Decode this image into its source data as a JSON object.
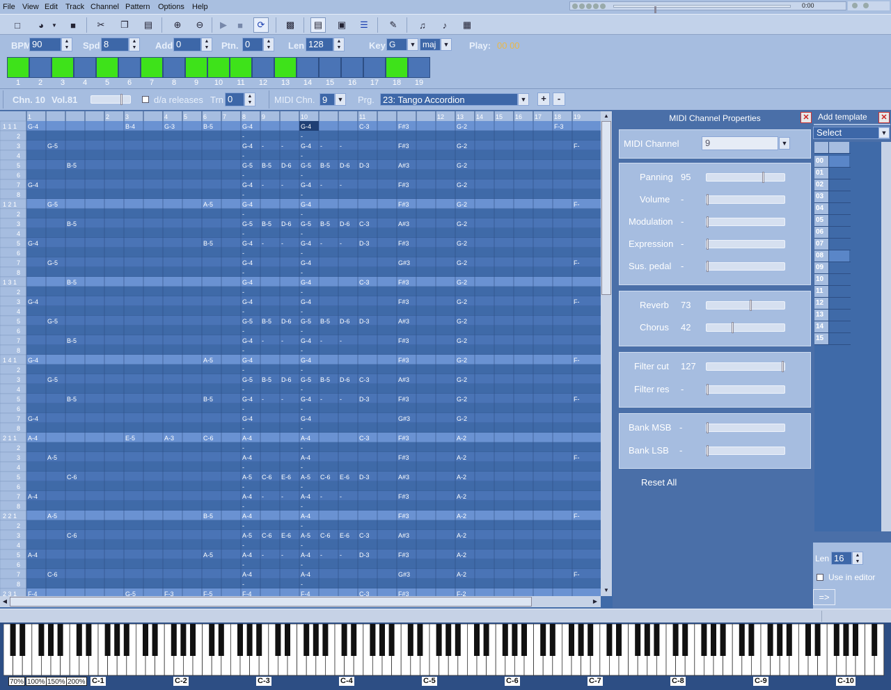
{
  "menu": [
    "File",
    "View",
    "Edit",
    "Track",
    "Channel",
    "Pattern",
    "Options",
    "Help"
  ],
  "transport": {
    "time": "0:00",
    "position": 0.23
  },
  "toolbar": {
    "icons": [
      "new-icon",
      "open-icon",
      "dropdown-arrow-icon",
      "save-icon",
      "cut-icon",
      "copy-icon",
      "paste-icon",
      "zoom-in-icon",
      "zoom-out-icon",
      "play-icon",
      "stop-icon",
      "loop-icon",
      "midi-keyboard-icon",
      "pattern-view-icon",
      "preview-icon",
      "track-view-icon",
      "pencil-icon",
      "note-add-icon",
      "note-edit-icon",
      "notepad-icon"
    ]
  },
  "settings": {
    "bpm_label": "BPM",
    "bpm": "90",
    "spd_label": "Spd",
    "spd": "8",
    "add_label": "Add",
    "add": "0",
    "ptn_label": "Ptn.",
    "ptn": "0",
    "len_label": "Len",
    "len": "128",
    "key_label": "Key",
    "key": "G",
    "mode": "maj",
    "play_label": "Play:",
    "play_value": "00 00"
  },
  "patterns": {
    "numbers": [
      "1",
      "2",
      "3",
      "4",
      "5",
      "6",
      "7",
      "8",
      "9",
      "10",
      "11",
      "12",
      "13",
      "14",
      "15",
      "16",
      "17",
      "18",
      "19"
    ],
    "active": [
      1,
      0,
      1,
      0,
      1,
      0,
      1,
      0,
      1,
      1,
      1,
      0,
      1,
      0,
      0,
      0,
      0,
      1,
      0
    ]
  },
  "channel_bar": {
    "chn": "Chn. 10",
    "vol": "Vol.81",
    "volume_level": 0.8,
    "da_releases": "d/a releases",
    "trn_label": "Trn",
    "trn": "0",
    "midi_chn_label": "MIDI Chn.",
    "midi_chn": "9",
    "prg_label": "Prg.",
    "prg": "23: Tango Accordion",
    "plus": "+",
    "minus": "-"
  },
  "grid": {
    "col_headers": [
      "",
      "1",
      "",
      "",
      "",
      "2",
      "3",
      "",
      "4",
      "5",
      "6",
      "7",
      "8",
      "9",
      "",
      "10",
      "",
      "",
      "11",
      "",
      "",
      "",
      "12",
      "13",
      "14",
      "15",
      "16",
      "17",
      "18",
      "19"
    ],
    "beat_labels": [
      "1 1 1",
      "2",
      "3",
      "4",
      "5",
      "6",
      "7",
      "8",
      "1 2 1",
      "2",
      "3",
      "4",
      "5",
      "6",
      "7",
      "8",
      "1 3 1",
      "2",
      "3",
      "4",
      "5",
      "6",
      "7",
      "8",
      "1 4 1",
      "2",
      "3",
      "4",
      "5",
      "6",
      "7",
      "8",
      "2 1 1",
      "2",
      "3",
      "4",
      "5",
      "6",
      "7",
      "8",
      "2 2 1",
      "2",
      "3",
      "4",
      "5",
      "6",
      "7",
      "8",
      "2 3 1"
    ],
    "rows": [
      {
        "1": "G-4",
        "6": "B-4",
        "8": "G-3",
        "10": "B-5",
        "12": "G-4",
        "15": "G-4",
        "18": "C-3",
        "20": "F#3",
        "23": "G-2",
        "28": "F-3"
      },
      {
        "12": "-",
        "15": "-"
      },
      {
        "2": "G-5",
        "12": "G-4",
        "13": "-",
        "14": "-",
        "15": "G-4",
        "16": "-",
        "17": "-",
        "20": "F#3",
        "23": "G-2",
        "29": "F-"
      },
      {
        "12": "-",
        "15": "-"
      },
      {
        "3": "B-5",
        "12": "G-5",
        "13": "B-5",
        "14": "D-6",
        "15": "G-5",
        "16": "B-5",
        "17": "D-6",
        "18": "D-3",
        "20": "A#3",
        "23": "G-2"
      },
      {
        "12": "-",
        "15": "-"
      },
      {
        "1": "G-4",
        "12": "G-4",
        "13": "-",
        "14": "-",
        "15": "G-4",
        "16": "-",
        "17": "-",
        "20": "F#3",
        "23": "G-2"
      },
      {
        "12": "-",
        "15": "-"
      },
      {
        "2": "G-5",
        "10": "A-5",
        "12": "G-4",
        "15": "G-4",
        "20": "F#3",
        "23": "G-2",
        "29": "F-"
      },
      {
        "12": "-",
        "15": "-"
      },
      {
        "3": "B-5",
        "12": "G-5",
        "13": "B-5",
        "14": "D-6",
        "15": "G-5",
        "16": "B-5",
        "17": "D-6",
        "18": "C-3",
        "20": "A#3",
        "23": "G-2"
      },
      {
        "12": "-",
        "15": "-"
      },
      {
        "1": "G-4",
        "10": "B-5",
        "12": "G-4",
        "13": "-",
        "14": "-",
        "15": "G-4",
        "16": "-",
        "17": "-",
        "18": "D-3",
        "20": "F#3",
        "23": "G-2"
      },
      {
        "12": "-",
        "15": "-"
      },
      {
        "2": "G-5",
        "12": "G-4",
        "15": "G-4",
        "20": "G#3",
        "23": "G-2",
        "29": "F-"
      },
      {
        "12": "-",
        "15": "-"
      },
      {
        "3": "B-5",
        "12": "G-4",
        "15": "G-4",
        "18": "C-3",
        "20": "F#3",
        "23": "G-2"
      },
      {
        "12": "-",
        "15": "-"
      },
      {
        "1": "G-4",
        "12": "G-4",
        "15": "G-4",
        "20": "F#3",
        "23": "G-2",
        "29": "F-"
      },
      {
        "12": "-",
        "15": "-"
      },
      {
        "2": "G-5",
        "12": "G-5",
        "13": "B-5",
        "14": "D-6",
        "15": "G-5",
        "16": "B-5",
        "17": "D-6",
        "18": "D-3",
        "20": "A#3",
        "23": "G-2"
      },
      {
        "12": "-",
        "15": "-"
      },
      {
        "3": "B-5",
        "12": "G-4",
        "13": "-",
        "14": "-",
        "15": "G-4",
        "16": "-",
        "17": "-",
        "20": "F#3",
        "23": "G-2"
      },
      {
        "12": "-",
        "15": "-"
      },
      {
        "1": "G-4",
        "10": "A-5",
        "12": "G-4",
        "15": "G-4",
        "20": "F#3",
        "23": "G-2",
        "29": "F-"
      },
      {
        "12": "-",
        "15": "-"
      },
      {
        "2": "G-5",
        "12": "G-5",
        "13": "B-5",
        "14": "D-6",
        "15": "G-5",
        "16": "B-5",
        "17": "D-6",
        "18": "C-3",
        "20": "A#3",
        "23": "G-2"
      },
      {
        "12": "-",
        "15": "-"
      },
      {
        "3": "B-5",
        "10": "B-5",
        "12": "G-4",
        "13": "-",
        "14": "-",
        "15": "G-4",
        "16": "-",
        "17": "-",
        "18": "D-3",
        "20": "F#3",
        "23": "G-2",
        "29": "F-"
      },
      {
        "12": "-",
        "15": "-"
      },
      {
        "1": "G-4",
        "12": "G-4",
        "15": "G-4",
        "20": "G#3",
        "23": "G-2"
      },
      {
        "12": "-",
        "15": "-"
      },
      {
        "1": "A-4",
        "6": "E-5",
        "8": "A-3",
        "10": "C-6",
        "12": "A-4",
        "15": "A-4",
        "18": "C-3",
        "20": "F#3",
        "23": "A-2"
      },
      {
        "12": "-",
        "15": "-"
      },
      {
        "2": "A-5",
        "12": "A-4",
        "15": "A-4",
        "20": "F#3",
        "23": "A-2",
        "29": "F-"
      },
      {
        "12": "-",
        "15": "-"
      },
      {
        "3": "C-6",
        "12": "A-5",
        "13": "C-6",
        "14": "E-6",
        "15": "A-5",
        "16": "C-6",
        "17": "E-6",
        "18": "D-3",
        "20": "A#3",
        "23": "A-2"
      },
      {
        "12": "-",
        "15": "-"
      },
      {
        "1": "A-4",
        "12": "A-4",
        "13": "-",
        "14": "-",
        "15": "A-4",
        "16": "-",
        "17": "-",
        "20": "F#3",
        "23": "A-2"
      },
      {
        "12": "-",
        "15": "-"
      },
      {
        "2": "A-5",
        "10": "B-5",
        "12": "A-4",
        "15": "A-4",
        "20": "F#3",
        "23": "A-2",
        "29": "F-"
      },
      {
        "12": "-",
        "15": "-"
      },
      {
        "3": "C-6",
        "12": "A-5",
        "13": "C-6",
        "14": "E-6",
        "15": "A-5",
        "16": "C-6",
        "17": "E-6",
        "18": "C-3",
        "20": "A#3",
        "23": "A-2"
      },
      {
        "12": "-",
        "15": "-"
      },
      {
        "1": "A-4",
        "10": "A-5",
        "12": "A-4",
        "13": "-",
        "14": "-",
        "15": "A-4",
        "16": "-",
        "17": "-",
        "18": "D-3",
        "20": "F#3",
        "23": "A-2"
      },
      {
        "12": "-",
        "15": "-"
      },
      {
        "2": "C-6",
        "12": "A-4",
        "15": "A-4",
        "20": "G#3",
        "23": "A-2",
        "29": "F-"
      },
      {
        "12": "-",
        "15": "-"
      },
      {
        "1": "F-4",
        "6": "G-5",
        "8": "F-3",
        "10": "F-5",
        "12": "F-4",
        "15": "F-4",
        "18": "C-3",
        "20": "F#3",
        "23": "F-2"
      }
    ]
  },
  "midi_props": {
    "title": "MIDI Channel Properties",
    "channel_label": "MIDI Channel",
    "channel": "9",
    "panning_label": "Panning",
    "panning": "95",
    "panning_level": 0.74,
    "volume_label": "Volume",
    "volume": "-",
    "volume_level": 0,
    "modulation_label": "Modulation",
    "modulation": "-",
    "modulation_level": 0,
    "expression_label": "Expression",
    "expression": "-",
    "expression_level": 0,
    "sus_label": "Sus. pedal",
    "sus": "-",
    "sus_level": 0,
    "reverb_label": "Reverb",
    "reverb": "73",
    "reverb_level": 0.57,
    "chorus_label": "Chorus",
    "chorus": "42",
    "chorus_level": 0.33,
    "filter_cut_label": "Filter cut",
    "filter_cut": "127",
    "filter_cut_level": 1,
    "filter_res_label": "Filter res",
    "filter_res": "-",
    "filter_res_level": 0,
    "bank_msb_label": "Bank MSB",
    "bank_msb": "-",
    "bank_msb_level": 0,
    "bank_lsb_label": "Bank LSB",
    "bank_lsb": "-",
    "bank_lsb_level": 0,
    "reset": "Reset All"
  },
  "template": {
    "title": "Add template",
    "select": "Select",
    "rows": [
      "00",
      "01",
      "02",
      "03",
      "04",
      "05",
      "06",
      "07",
      "08",
      "09",
      "10",
      "11",
      "12",
      "13",
      "14",
      "15"
    ],
    "highlighted": [
      0,
      8
    ],
    "len_label": "Len",
    "len": "16",
    "use_in_editor": "Use in editor",
    "apply": "=>"
  },
  "keyboard": {
    "zoom": [
      "70%",
      "100%",
      "150%",
      "200%"
    ],
    "octaves": [
      "C-1",
      "C-2",
      "C-3",
      "C-4",
      "C-5",
      "C-6",
      "C-7",
      "C-8",
      "C-9",
      "C-10"
    ]
  },
  "colors": {
    "green": "#3ee21a",
    "grid_dark": "#3f6aa8",
    "grid_mid": "#4a74b6",
    "grid_light": "#6a92d2"
  }
}
